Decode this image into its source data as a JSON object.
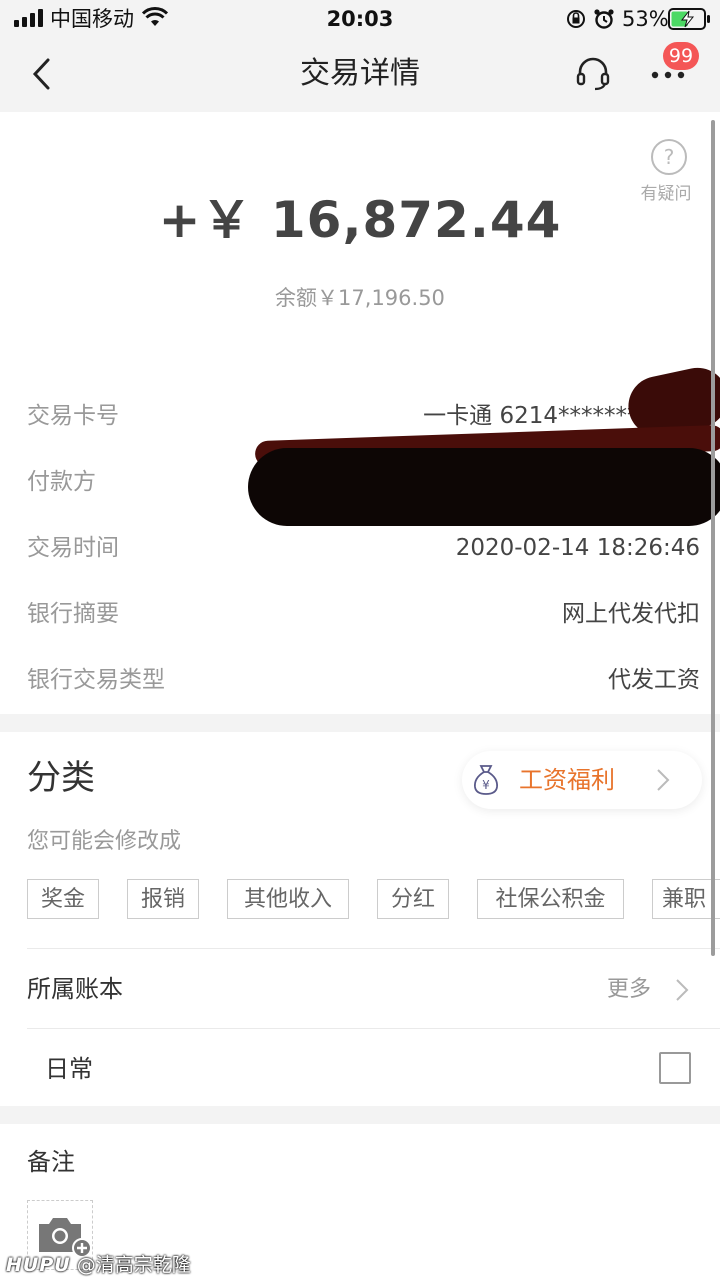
{
  "status_bar": {
    "carrier": "中国移动",
    "time": "20:03",
    "battery_percent": "53%",
    "battery_level": 0.53,
    "icons": [
      "signal-icon",
      "wifi-icon",
      "orientation-lock-icon",
      "alarm-icon",
      "battery-charging-icon"
    ]
  },
  "nav": {
    "title": "交易详情",
    "badge": "99",
    "icons": [
      "back-icon",
      "headset-icon",
      "more-icon"
    ]
  },
  "summary": {
    "amount": "+￥ 16,872.44",
    "balance": "余额￥17,196.50",
    "help_label": "有疑问",
    "help_glyph": "?"
  },
  "details": [
    {
      "label": "交易卡号",
      "value": "一卡通 6214********"
    },
    {
      "label": "付款方",
      "value": ""
    },
    {
      "label": "交易时间",
      "value": "2020-02-14 18:26:46"
    },
    {
      "label": "银行摘要",
      "value": "网上代发代扣"
    },
    {
      "label": "银行交易类型",
      "value": "代发工资"
    }
  ],
  "category": {
    "title": "分类",
    "current": "工资福利",
    "current_icon": "money-bag-icon",
    "hint": "您可能会修改成",
    "tags": [
      "奖金",
      "报销",
      "其他收入",
      "分红",
      "社保公积金",
      "兼职"
    ]
  },
  "ledger": {
    "label": "所属账本",
    "more": "更多",
    "book": "日常",
    "checked": false
  },
  "note": {
    "label": "备注",
    "icon": "camera-add-icon"
  },
  "watermark": {
    "logo": "HUPU",
    "user": "@清高宗乾隆"
  },
  "colors": {
    "accent": "#e8742c",
    "badge": "#f45656",
    "background": "#f3f3f3",
    "muted_text": "#999999"
  }
}
